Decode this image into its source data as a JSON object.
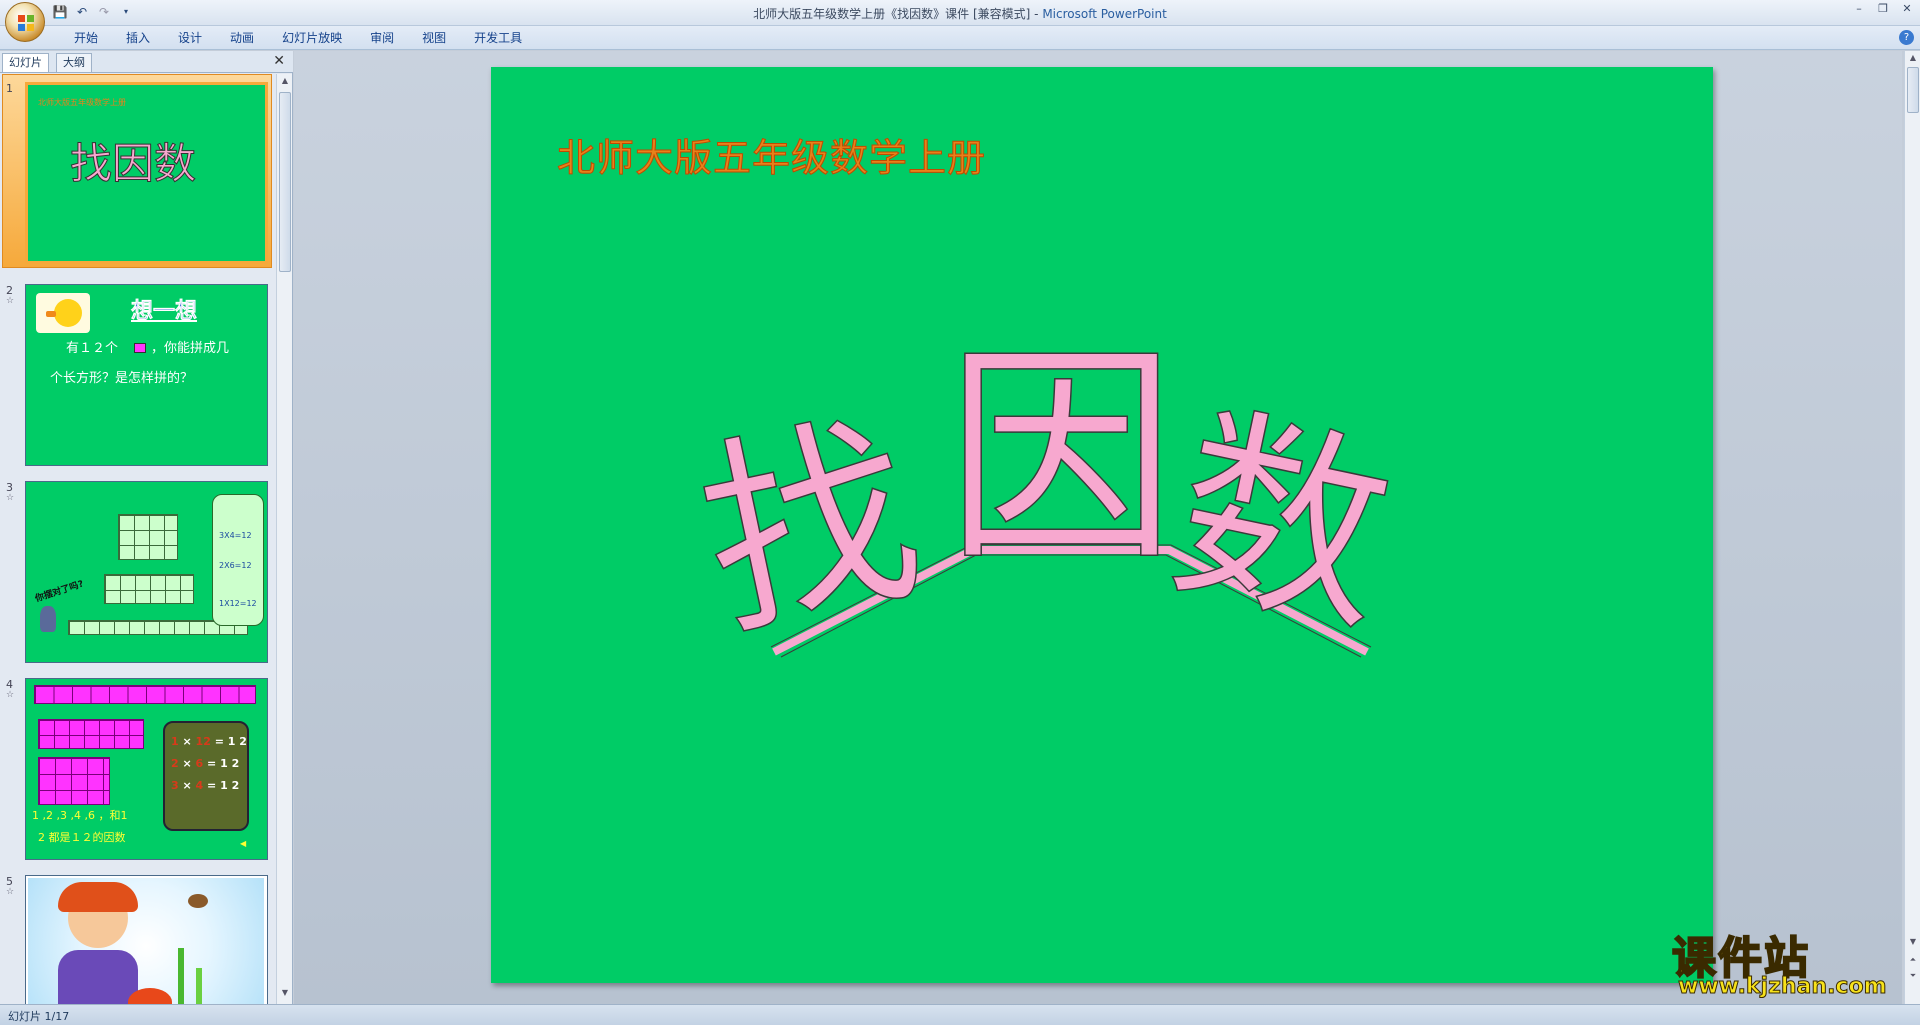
{
  "window": {
    "title": "北师大版五年级数学上册《找因数》课件 [兼容模式] - ",
    "app_name": "Microsoft PowerPoint"
  },
  "ribbon": {
    "tabs": [
      "开始",
      "插入",
      "设计",
      "动画",
      "幻灯片放映",
      "审阅",
      "视图",
      "开发工具"
    ]
  },
  "left_pane": {
    "tabs": [
      "幻灯片",
      "大纲"
    ],
    "close_label": "✕"
  },
  "thumbnails": [
    {
      "num": "1",
      "small_title": "北师大版五年级数学上册",
      "big_title": "找因数"
    },
    {
      "num": "2",
      "title": "想一想",
      "line1a": "有１２个",
      "line1b": "，你能拼成几",
      "line2": "个长方形？是怎样拼的？"
    },
    {
      "num": "3",
      "eqs": [
        "3X4=12",
        "2X6=12",
        "1X12=12"
      ],
      "tag": "你摆对了吗?"
    },
    {
      "num": "4",
      "eqs": [
        {
          "a": "1",
          "b": "12",
          "r": "= 1 2"
        },
        {
          "a": "2",
          "b": "6",
          "r": "= 1 2"
        },
        {
          "a": "3",
          "b": "4",
          "r": "= 1 2"
        }
      ],
      "line1": "1 ,2 ,3 ,4 ,6 ，和1",
      "line2": "2 都是１２的因数"
    },
    {
      "num": "5"
    }
  ],
  "slide": {
    "subtitle": "北师大版五年级数学上册",
    "title_chars": [
      "找",
      "因",
      "数"
    ],
    "title_color": "#f7a8cf",
    "background": "#00cc66"
  },
  "watermark": {
    "big": "课件站",
    "url": "www.kjzhan.com"
  },
  "status": {
    "text": "幻灯片 1/17"
  }
}
